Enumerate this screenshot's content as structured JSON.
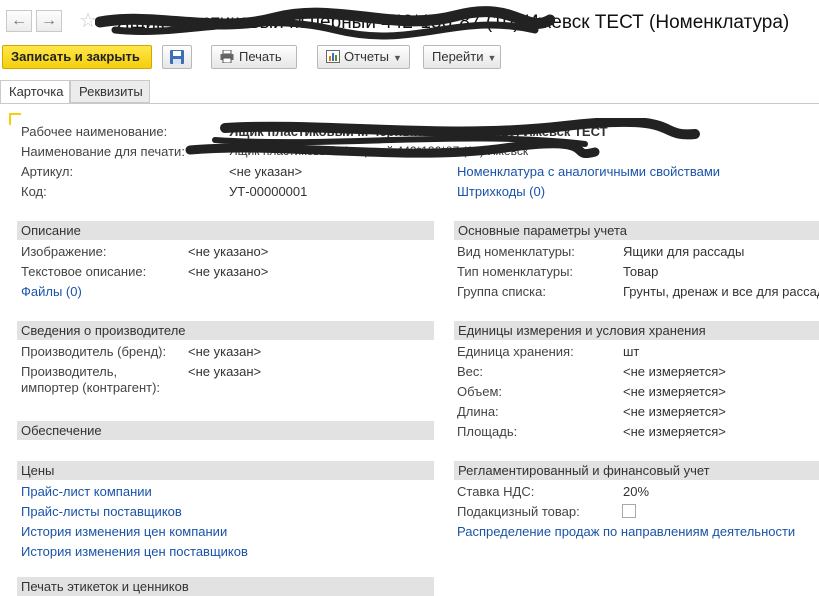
{
  "window": {
    "title": "Ящик пластиковый М черный 442*186*87 (10) Ижевск ТЕСТ (Номенклатура)"
  },
  "toolbar": {
    "save_close_label": "Записать и закрыть",
    "print_label": "Печать",
    "reports_label": "Отчеты",
    "goto_label": "Перейти"
  },
  "tabs": [
    {
      "label": "Карточка"
    },
    {
      "label": "Реквизиты"
    }
  ],
  "header": {
    "work_name_label": "Рабочее наименование:",
    "work_name_value": "Ящик пластиковый М черный 442*186*87 (10) Ижевск ТЕСТ",
    "print_name_label": "Наименование для печати:",
    "print_name_value": "Ящик пластиковый М черный 442*186*87 (10) Ижевск",
    "article_label": "Артикул:",
    "article_value": "<не указан>",
    "code_label": "Код:",
    "code_value": "УТ-00000001",
    "similar_link": "Номенклатура с аналогичными свойствами",
    "barcodes_link": "Штрихкоды (0)"
  },
  "description": {
    "title": "Описание",
    "image_label": "Изображение:",
    "image_value": "<не указано>",
    "text_label": "Текстовое описание:",
    "text_value": "<не указано>",
    "files_link": "Файлы (0)"
  },
  "manufacturer": {
    "title": "Сведения о производителе",
    "brand_label": "Производитель (бренд):",
    "brand_value": "<не указан>",
    "producer_label_1": "Производитель,",
    "producer_label_2": "импортер (контрагент):",
    "producer_value": "<не указан>"
  },
  "supply": {
    "title": "Обеспечение"
  },
  "prices": {
    "title": "Цены",
    "links": [
      "Прайс-лист компании",
      "Прайс-листы поставщиков",
      "История изменения цен компании",
      "История изменения цен поставщиков"
    ]
  },
  "labels_section": {
    "title": "Печать этикеток и ценников"
  },
  "accounting": {
    "title": "Основные параметры учета",
    "kind_label": "Вид номенклатуры:",
    "kind_value": "Ящики для рассады",
    "type_label": "Тип номенклатуры:",
    "type_value": "Товар",
    "group_label": "Группа списка:",
    "group_value": "Грунты, дренаж и все для рассады"
  },
  "units": {
    "title": "Единицы измерения и условия хранения",
    "unit_label": "Единица хранения:",
    "unit_value": "шт",
    "weight_label": "Вес:",
    "weight_value": "<не измеряется>",
    "volume_label": "Объем:",
    "volume_value": "<не измеряется>",
    "length_label": "Длина:",
    "length_value": "<не измеряется>",
    "area_label": "Площадь:",
    "area_value": "<не измеряется>"
  },
  "regulated": {
    "title": "Регламентированный и финансовый учет",
    "vat_label": "Ставка НДС:",
    "vat_value": "20%",
    "excise_label": "Подакцизный товар:",
    "excise_checked": false,
    "distribution_link": "Распределение продаж по направлениям деятельности"
  }
}
